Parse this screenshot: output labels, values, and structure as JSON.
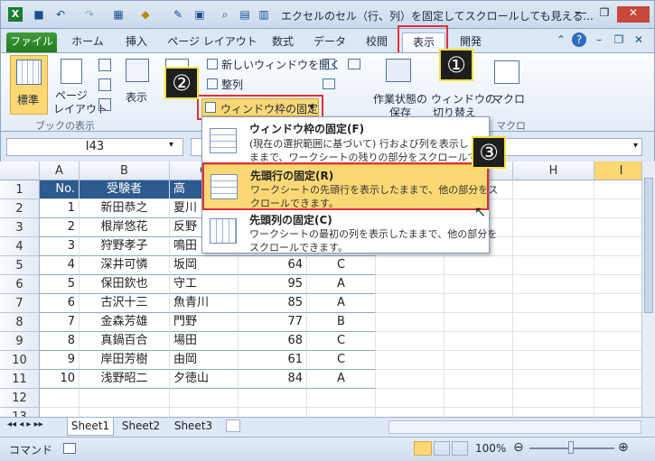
{
  "window": {
    "title": "エクセルのセル（行、列）を固定してスクロールしても見える..."
  },
  "tabs": {
    "file": "ファイル",
    "home": "ホーム",
    "insert": "挿入",
    "layout": "ページ レイアウト",
    "formulas": "数式",
    "data": "データ",
    "review": "校閲",
    "view": "表示",
    "developer": "開発"
  },
  "ribbon": {
    "normal": "標準",
    "page_layout_1": "ページ",
    "page_layout_2": "レイアウト",
    "book_view_group": "ブックの表示",
    "show": "表示",
    "new_window": "新しいウィンドウを開く",
    "arrange": "整列",
    "freeze_panes": "ウィンドウ枠の固定",
    "workspace_1": "作業状態の",
    "workspace_2": "保存",
    "switch_1": "ウィンドウの",
    "switch_2": "切り替え",
    "macro": "マクロ",
    "macro_group": "マクロ"
  },
  "callouts": {
    "c1": "①",
    "c2": "②",
    "c3": "③"
  },
  "namebox": "I43",
  "freeze_menu": {
    "items": [
      {
        "title": "ウィンドウ枠の固定(F)",
        "desc1": "(現在の選択範囲に基づいて) 行および列を表示し",
        "desc2": "ままで、ワークシートの残りの部分をスクロールできま"
      },
      {
        "title": "先頭行の固定(R)",
        "desc1": "ワークシートの先頭行を表示したままで、他の部分をス",
        "desc2": "クロールできます。"
      },
      {
        "title": "先頭列の固定(C)",
        "desc1": "ワークシートの最初の列を表示したままで、他の部分を",
        "desc2": "スクロールできます。"
      }
    ]
  },
  "columns": [
    "A",
    "B",
    "C",
    "H",
    "I"
  ],
  "rows": [
    {
      "n": "1",
      "a": "No.",
      "b": "受験者",
      "c": "高",
      "d": "",
      "e": ""
    },
    {
      "n": "2",
      "a": "1",
      "b": "新田恭之",
      "c": "夏川",
      "d": "",
      "e": ""
    },
    {
      "n": "3",
      "a": "2",
      "b": "根岸悠花",
      "c": "反野",
      "d": "",
      "e": ""
    },
    {
      "n": "4",
      "a": "3",
      "b": "狩野孝子",
      "c": "鳴田",
      "d": "",
      "e": ""
    },
    {
      "n": "5",
      "a": "4",
      "b": "深井可憐",
      "c": "坂岡",
      "d": "64",
      "e": "C"
    },
    {
      "n": "6",
      "a": "5",
      "b": "保田欽也",
      "c": "守工",
      "d": "95",
      "e": "A"
    },
    {
      "n": "7",
      "a": "6",
      "b": "古沢十三",
      "c": "魚青川",
      "d": "85",
      "e": "A"
    },
    {
      "n": "8",
      "a": "7",
      "b": "金森芳雄",
      "c": "門野",
      "d": "77",
      "e": "B"
    },
    {
      "n": "9",
      "a": "8",
      "b": "真鍋百合",
      "c": "場田",
      "d": "68",
      "e": "C"
    },
    {
      "n": "10",
      "a": "9",
      "b": "岸田芳樹",
      "c": "由岡",
      "d": "61",
      "e": "C"
    },
    {
      "n": "11",
      "a": "10",
      "b": "浅野昭二",
      "c": "夕徳山",
      "d": "84",
      "e": "A"
    },
    {
      "n": "12",
      "a": "",
      "b": "",
      "c": "",
      "d": "",
      "e": ""
    },
    {
      "n": "13",
      "a": "",
      "b": "",
      "c": "",
      "d": "",
      "e": ""
    }
  ],
  "sheets": [
    "Sheet1",
    "Sheet2",
    "Sheet3"
  ],
  "status": {
    "mode": "コマンド",
    "zoom": "100%"
  },
  "colors": {
    "header_fill": "#2e5a8f",
    "highlight": "#fbd874",
    "red": "#e0303a"
  }
}
